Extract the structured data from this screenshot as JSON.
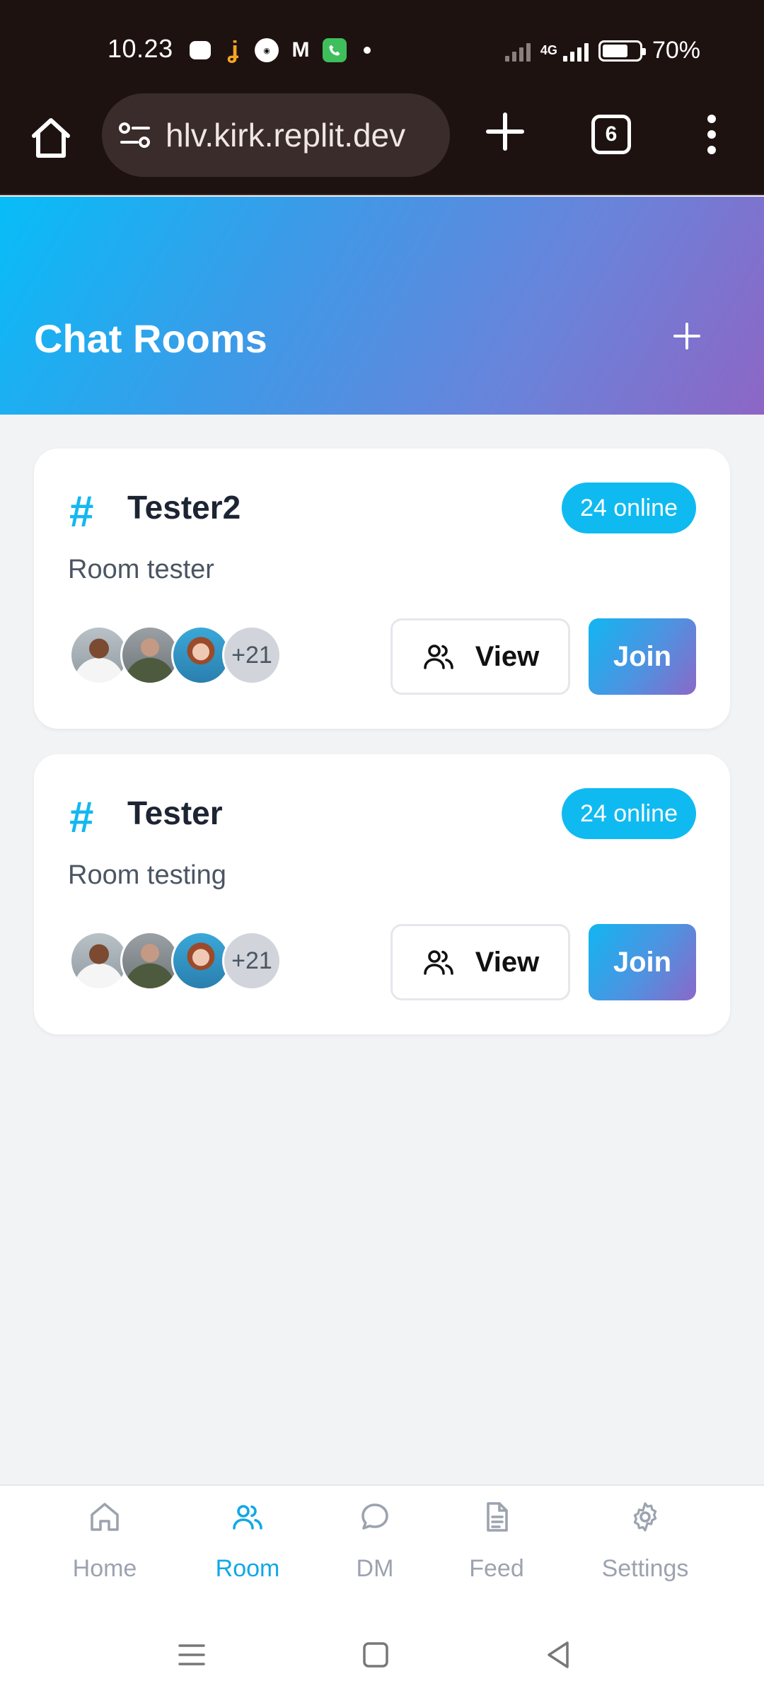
{
  "status_bar": {
    "time": "10.23",
    "network": "4G",
    "battery": "70%",
    "battery_level": 0.7
  },
  "browser": {
    "url": "hlv.kirk.replit.dev",
    "tab_count": "6"
  },
  "header": {
    "title": "Chat Rooms"
  },
  "rooms": [
    {
      "name": "Tester2",
      "online": "24 online",
      "description": "Room tester",
      "extra_members": "+21",
      "view_label": "View",
      "join_label": "Join"
    },
    {
      "name": "Tester",
      "online": "24 online",
      "description": "Room testing",
      "extra_members": "+21",
      "view_label": "View",
      "join_label": "Join"
    }
  ],
  "bottom_nav": {
    "items": [
      {
        "label": "Home",
        "icon": "home-icon",
        "active": false
      },
      {
        "label": "Room",
        "icon": "users-icon",
        "active": true
      },
      {
        "label": "DM",
        "icon": "chat-bubble-icon",
        "active": false
      },
      {
        "label": "Feed",
        "icon": "document-icon",
        "active": false
      },
      {
        "label": "Settings",
        "icon": "gear-icon",
        "active": false
      }
    ]
  },
  "colors": {
    "accent": "#0fbaf1",
    "header_gradient_start": "#07bdf8",
    "header_gradient_end": "#8d66c5"
  }
}
